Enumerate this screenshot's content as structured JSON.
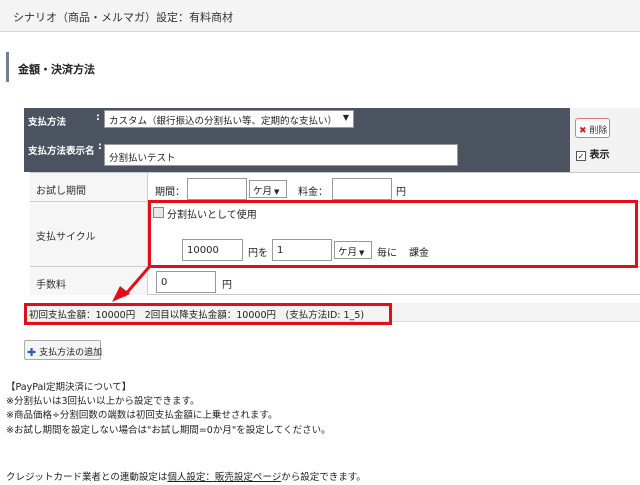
{
  "header": {
    "title": "シナリオ（商品・メルマガ）設定：有料商材"
  },
  "section": {
    "title": "金額・決済方法"
  },
  "payment": {
    "method_label": "支払方法",
    "method_colon": ":",
    "method_value": "カスタム（銀行振込の分割払い等、定期的な支払い）",
    "name_label": "支払方法表示名",
    "name_colon": ":",
    "name_value": "分割払いテスト",
    "delete_label": "削除",
    "show_label": "表示",
    "show_checked": "✓"
  },
  "trial": {
    "label": "お試し期間",
    "period_label": "期間：",
    "period_unit": "ケ月",
    "fee_label": "料金：",
    "fee_unit": "円"
  },
  "cycle": {
    "label": "支払サイクル",
    "installment_label": "分割払いとして使用",
    "amount": "10000",
    "amount_suffix": "円を",
    "count": "1",
    "unit": "ケ月",
    "every": "毎に",
    "charge": "課金"
  },
  "fee": {
    "label": "手数料",
    "value": "0",
    "unit": "円"
  },
  "summary": "初回支払金額：10000円　2回目以降支払金額：10000円　(支払方法ID: 1_5)",
  "add_button": "支払方法の追加",
  "notes": [
    "【PayPal定期決済について】",
    "※分割払いは3回払い以上から設定できます。",
    "※商品価格÷分割回数の端数は初回支払金額に上乗せされます。",
    "※お試し期間を設定しない場合は\"お試し期間=0か月\"を設定してください。"
  ],
  "footer": {
    "prefix": "クレジットカード業者との連動設定は",
    "link": "個人設定：販売設定ページ",
    "suffix": "から設定できます。"
  },
  "colors": {
    "highlight": "#e0101a",
    "dark_panel": "#4b5260"
  }
}
